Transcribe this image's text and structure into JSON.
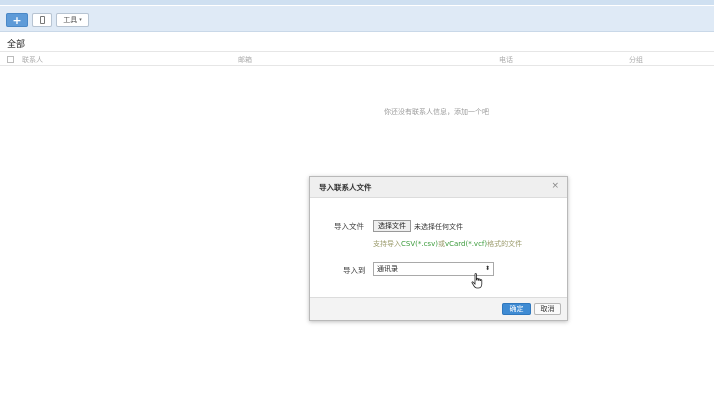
{
  "toolbar": {
    "add_label": "+",
    "tools_label": "工具",
    "caret": "▾"
  },
  "section": {
    "title": "全部"
  },
  "table": {
    "columns": [
      "联系人",
      "邮箱",
      "电话",
      "分组"
    ]
  },
  "empty_message": "你还没有联系人信息，添加一个吧",
  "dialog": {
    "title": "导入联系人文件",
    "close": "×",
    "file_label": "导入文件",
    "file_button": "选择文件",
    "no_file": "未选择任何文件",
    "hint_prefix": "支持导入",
    "hint_fmt1": "CSV(*.csv)",
    "hint_mid": "或",
    "hint_fmt2": "vCard(*.vcf)",
    "hint_suffix": "格式的文件",
    "import_to_label": "导入到",
    "import_to_value": "通讯录",
    "select_arrow": "⬍",
    "ok": "确定",
    "cancel": "取消"
  },
  "colors": {
    "toolbar_bg": "#dfeaf6",
    "primary": "#3f8bd3",
    "hint_format": "#3a9a3a"
  }
}
